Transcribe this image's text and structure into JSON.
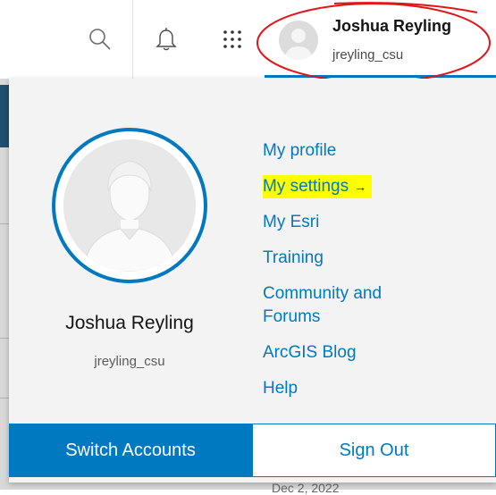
{
  "header": {
    "icons": [
      "search-icon",
      "bell-icon",
      "apps-grid-icon"
    ],
    "user": {
      "display_name": "Joshua Reyling",
      "username": "jreyling_csu"
    }
  },
  "panel": {
    "user": {
      "display_name": "Joshua Reyling",
      "username": "jreyling_csu"
    },
    "menu": [
      {
        "label": "My profile"
      },
      {
        "label": "My settings",
        "highlighted": true,
        "arrow": "→"
      },
      {
        "label": "My Esri"
      },
      {
        "label": "Training"
      },
      {
        "label": "Community and Forums"
      },
      {
        "label": "ArcGIS Blog"
      },
      {
        "label": "Help"
      }
    ],
    "buttons": {
      "switch_accounts": "Switch Accounts",
      "sign_out": "Sign Out"
    }
  },
  "background": {
    "date_text": "Dec 2, 2022"
  },
  "colors": {
    "accent": "#0079c1",
    "highlight": "#ffff00",
    "annotation": "#e0161b"
  }
}
